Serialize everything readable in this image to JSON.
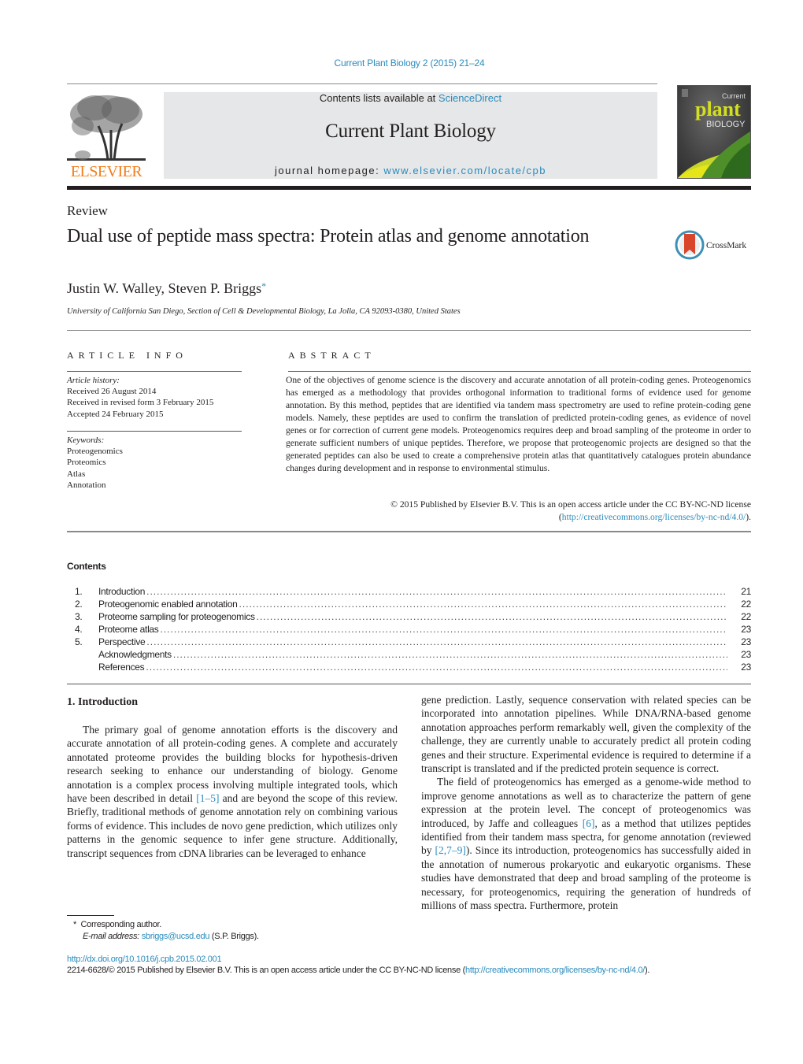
{
  "header": {
    "citation": "Current Plant Biology 2 (2015) 21–24",
    "publisher_wordmark": "ELSEVIER",
    "contents_prefix": "Contents lists available at ",
    "contents_link": "ScienceDirect",
    "journal_name": "Current Plant Biology",
    "homepage_prefix": "journal homepage: ",
    "homepage_link": "www.elsevier.com/locate/cpb",
    "cover": {
      "line1": "Current",
      "line2": "plant",
      "line3": "BIOLOGY"
    }
  },
  "article": {
    "type": "Review",
    "title": "Dual use of peptide mass spectra: Protein atlas and genome annotation",
    "crossmark_label": "CrossMark",
    "authors": "Justin W. Walley, Steven P. Briggs",
    "author_mark": "*",
    "affiliation": "University of California San Diego, Section of Cell & Developmental Biology, La Jolla, CA 92093-0380, United States"
  },
  "article_info": {
    "heading": "ARTICLE INFO",
    "history_label": "Article history:",
    "history": [
      "Received 26 August 2014",
      "Received in revised form 3 February 2015",
      "Accepted 24 February 2015"
    ],
    "keywords_label": "Keywords:",
    "keywords": [
      "Proteogenomics",
      "Proteomics",
      "Atlas",
      "Annotation"
    ]
  },
  "abstract": {
    "heading": "ABSTRACT",
    "text": "One of the objectives of genome science is the discovery and accurate annotation of all protein-coding genes. Proteogenomics has emerged as a methodology that provides orthogonal information to traditional forms of evidence used for genome annotation. By this method, peptides that are identified via tandem mass spectrometry are used to refine protein-coding gene models. Namely, these peptides are used to confirm the translation of predicted protein-coding genes, as evidence of novel genes or for correction of current gene models. Proteogenomics requires deep and broad sampling of the proteome in order to generate sufficient numbers of unique peptides. Therefore, we propose that proteogenomic projects are designed so that the generated peptides can also be used to create a comprehensive protein atlas that quantitatively catalogues protein abundance changes during development and in response to environmental stimulus.",
    "copyright": "© 2015 Published by Elsevier B.V. This is an open access article under the CC BY-NC-ND license",
    "license_open": "(",
    "license_link": "http://creativecommons.org/licenses/by-nc-nd/4.0/",
    "license_close": ")."
  },
  "contents": {
    "heading": "Contents",
    "items": [
      {
        "num": "1.",
        "label": "Introduction",
        "page": "21"
      },
      {
        "num": "2.",
        "label": "Proteogenomic enabled annotation",
        "page": "22"
      },
      {
        "num": "3.",
        "label": "Proteome sampling for proteogenomics",
        "page": "22"
      },
      {
        "num": "4.",
        "label": "Proteome atlas",
        "page": "23"
      },
      {
        "num": "5.",
        "label": "Perspective",
        "page": "23"
      },
      {
        "num": "",
        "label": "Acknowledgments",
        "page": "23"
      },
      {
        "num": "",
        "label": "References",
        "page": "23"
      }
    ]
  },
  "body": {
    "section_heading": "1.  Introduction",
    "left": {
      "p1_a": "The primary goal of genome annotation efforts is the discovery and accurate annotation of all protein-coding genes. A complete and accurately annotated proteome provides the building blocks for hypothesis-driven research seeking to enhance our understanding of biology. Genome annotation is a complex process involving multiple integrated tools, which have been described in detail ",
      "p1_ref": "[1–5]",
      "p1_b": " and are beyond the scope of this review. Briefly, traditional methods of genome annotation rely on combining various forms of evidence. This includes de novo gene prediction, which utilizes only patterns in the genomic sequence to infer gene structure. Additionally, transcript sequences from cDNA libraries can be leveraged to enhance"
    },
    "right": {
      "p1": "gene prediction. Lastly, sequence conservation with related species can be incorporated into annotation pipelines. While DNA/RNA-based genome annotation approaches perform remarkably well, given the complexity of the challenge, they are currently unable to accurately predict all protein coding genes and their structure. Experimental evidence is required to determine if a transcript is translated and if the predicted protein sequence is correct.",
      "p2_a": "The field of proteogenomics has emerged as a genome-wide method to improve genome annotations as well as to characterize the pattern of gene expression at the protein level. The concept of proteogenomics was introduced, by Jaffe and colleagues ",
      "p2_ref1": "[6]",
      "p2_b": ", as a method that utilizes peptides identified from their tandem mass spectra, for genome annotation (reviewed by ",
      "p2_ref2": "[2,7–9]",
      "p2_c": "). Since its introduction, proteogenomics has successfully aided in the annotation of numerous prokaryotic and eukaryotic organisms. These studies have demonstrated that deep and broad sampling of the proteome is necessary, for proteogenomics, requiring the generation of hundreds of millions of mass spectra. Furthermore, protein"
    }
  },
  "footnote": {
    "mark": "*",
    "corresponding": "Corresponding author.",
    "email_label": "E-mail address:",
    "email": "sbriggs@ucsd.edu",
    "email_suffix": " (S.P. Briggs)."
  },
  "footer": {
    "doi": "http://dx.doi.org/10.1016/j.cpb.2015.02.001",
    "issn_text": "2214-6628/© 2015 Published by Elsevier B.V. This is an open access article under the CC BY-NC-ND license (",
    "issn_link": "http://creativecommons.org/licenses/by-nc-nd/4.0/",
    "issn_close": ")."
  },
  "colors": {
    "link": "#2a8bbd",
    "elsevier_orange": "#f07f1e",
    "banner_bg": "#e6e7e8",
    "text": "#231f20"
  }
}
